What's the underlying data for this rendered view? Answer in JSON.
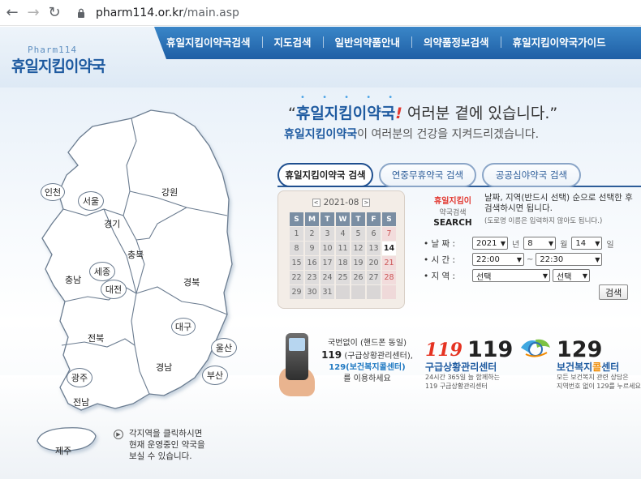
{
  "browser": {
    "url_host": "pharm114.or.kr",
    "url_path": "/main.asp"
  },
  "site": {
    "logo_en": "Pharm114",
    "logo_ko": "휴일지킴이약국"
  },
  "menu": [
    "휴일지킴이약국검색",
    "지도검색",
    "일반의약품안내",
    "의약품정보검색",
    "휴일지킴이약국가이드"
  ],
  "tagline": {
    "line1_brand": "휴일지킴이약국",
    "line1_mark": "!",
    "line1_rest": " 여러분 곁에 있습니다.",
    "line1_open": "“",
    "line1_close": "”",
    "line2_brand": "휴일지킴이약국",
    "line2_rest": "이 여러분의 건강을 지켜드리겠습니다."
  },
  "tabs": [
    "휴일지킴이약국 검색",
    "연중무휴약국 검색",
    "공공심야약국 검색"
  ],
  "calendar": {
    "month": "2021-08",
    "prev": "<",
    "next": ">",
    "dow": [
      "S",
      "M",
      "T",
      "W",
      "T",
      "F",
      "S"
    ],
    "days": [
      "1",
      "2",
      "3",
      "4",
      "5",
      "6",
      "7",
      "8",
      "9",
      "10",
      "11",
      "12",
      "13",
      "14",
      "15",
      "16",
      "17",
      "18",
      "19",
      "20",
      "21",
      "22",
      "23",
      "24",
      "25",
      "26",
      "27",
      "28",
      "29",
      "30",
      "31"
    ],
    "today": "14"
  },
  "search_panel": {
    "title1": "휴일지킴이",
    "title2": "약국검색",
    "title3": "SEARCH",
    "desc1": "날짜, 지역(반드시 선택) 순으로 선택한 후 검색하시면 됩니다.",
    "desc2": "(도로명 이름은 입력하지 않아도 됩니다.)",
    "date_label": "• 날 짜 :",
    "year": "2021",
    "year_unit": "년",
    "month": "8",
    "month_unit": "월",
    "day": "14",
    "day_unit": "일",
    "time_label": "• 시 간 :",
    "time_from": "22:00",
    "time_sep": "~",
    "time_to": "22:30",
    "region_label": "• 지 역 :",
    "region1": "선택",
    "region2": "선택",
    "search_button": "검색"
  },
  "map": {
    "regions": [
      "인천",
      "서울",
      "경기",
      "강원",
      "충북",
      "충남",
      "세종",
      "대전",
      "경북",
      "대구",
      "전북",
      "울산",
      "경남",
      "광주",
      "부산",
      "전남",
      "제주"
    ],
    "note": [
      "각지역을 클릭하시면",
      "현재 운영중인 약국을",
      "보실 수 있습니다."
    ]
  },
  "banner_mobile": {
    "line1": "국번없이 (핸드폰 동일)",
    "line2_num": "119",
    "line2_rest": "(구급상황관리센터),",
    "line3": "129(보건복지콜센터)",
    "line4": "를 이용하세요"
  },
  "banner_119": {
    "logo": "119",
    "number": "119",
    "title": "구급상황관리센터",
    "desc1": "24시간 365일 늘 함께하는",
    "desc2": "119 구급상황관리센터"
  },
  "banner_129": {
    "number": "129",
    "title_a": "보건복지",
    "title_b": "콜",
    "title_c": "센터",
    "desc1": "모든 보건복지 관련 상담은",
    "desc2": "지역번호 없이 129를 누르세요."
  }
}
